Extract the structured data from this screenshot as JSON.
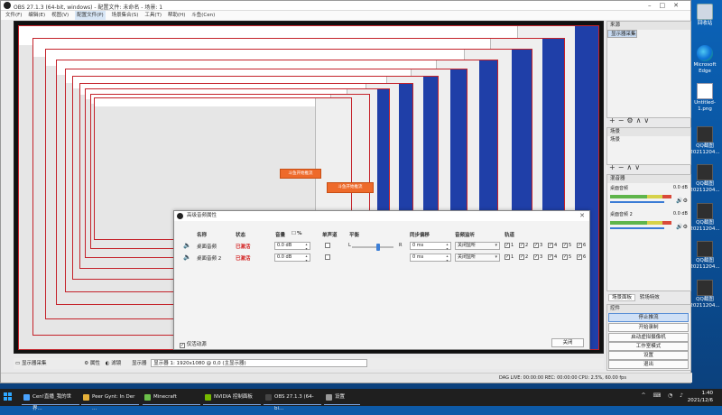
{
  "window": {
    "title": "OBS 27.1.3 (64-bit, windows) - 配置文件: 未命名 - 场景: 1",
    "menu": [
      "文件(F)",
      "编辑(E)",
      "视图(V)",
      "配置文件(P)",
      "场景集合(S)",
      "工具(T)",
      "帮助(H)",
      "斗鱼(Cen)"
    ]
  },
  "preview": {
    "orange_labels": [
      "斗鱼开始推流",
      "斗鱼开始推流"
    ]
  },
  "audio_dialog": {
    "title": "高级音频属性",
    "headers": [
      "名称",
      "状态",
      "音量",
      "%",
      "单声道",
      "平衡",
      "同步偏移",
      "音频监听",
      "轨道"
    ],
    "balance_left": "L",
    "balance_right": "R",
    "rows": [
      {
        "name": "桌面音频",
        "status": "已激活",
        "volume": "0.0 dB",
        "offset": "0 ms",
        "monitor": "关闭监听",
        "tracks": [
          "1",
          "2",
          "3",
          "4",
          "5",
          "6"
        ]
      },
      {
        "name": "桌面音频 2",
        "status": "已激活",
        "volume": "0.0 dB",
        "offset": "0 ms",
        "monitor": "关闭监听",
        "tracks": [
          "1",
          "2",
          "3",
          "4",
          "5",
          "6"
        ]
      }
    ],
    "advanced_label": "仅活动源",
    "close_label": "关闭"
  },
  "docks": {
    "sources_title": "来源",
    "source_item": "显示器采集",
    "scenes_title": "场景",
    "scene_item": "场景",
    "mixer_title": "混音器",
    "mixer": [
      {
        "name": "桌面音频",
        "db": "0.0 dB"
      },
      {
        "name": "桌面音频 2",
        "db": "0.0 dB"
      }
    ],
    "tabs": [
      "场景面板",
      "转场特效"
    ],
    "controls_title": "控件",
    "controls": [
      "停止推流",
      "开始录制",
      "启动虚拟摄像机",
      "工作室模式",
      "设置",
      "退出"
    ]
  },
  "bottom_toolbar": {
    "source": "显示器采集",
    "properties": "属性",
    "filters": "滤镜",
    "display_label": "显示器",
    "display_value": "显示器 1: 1920x1080 @ 0,0 (主显示器)"
  },
  "statusbar": {
    "text": "DAG LIVE: 00:00:00   REC: 00:00:00   CPU: 2.5%, 60.00 fps"
  },
  "desktop_icons": [
    {
      "label": "回收站",
      "kind": "recycle"
    },
    {
      "label": "Microsoft Edge",
      "kind": "edge"
    },
    {
      "label": "Untitled-1.png",
      "kind": "doc"
    },
    {
      "label": "QQ截图 20211204...",
      "kind": "qq"
    },
    {
      "label": "QQ截图 20211204...",
      "kind": "qq"
    },
    {
      "label": "QQ截图 20211204...",
      "kind": "qq"
    },
    {
      "label": "QQ截图 20211204...",
      "kind": "qq"
    },
    {
      "label": "QQ截图 20211204...",
      "kind": "qq"
    }
  ],
  "taskbar": {
    "items": [
      {
        "label": "Cen!直播_我的世界...",
        "color": "#4aa3ff"
      },
      {
        "label": "Peer Gynt: In Der ...",
        "color": "#e6b13a"
      },
      {
        "label": "Minecraft",
        "color": "#6bbf4a"
      },
      {
        "label": "NVIDIA 控制面板",
        "color": "#76b900"
      },
      {
        "label": "OBS 27.1.3 (64-bi...",
        "color": "#222222"
      },
      {
        "label": "设置",
        "color": "#999999"
      }
    ],
    "time": "1:40",
    "date": "2021/12/6"
  }
}
